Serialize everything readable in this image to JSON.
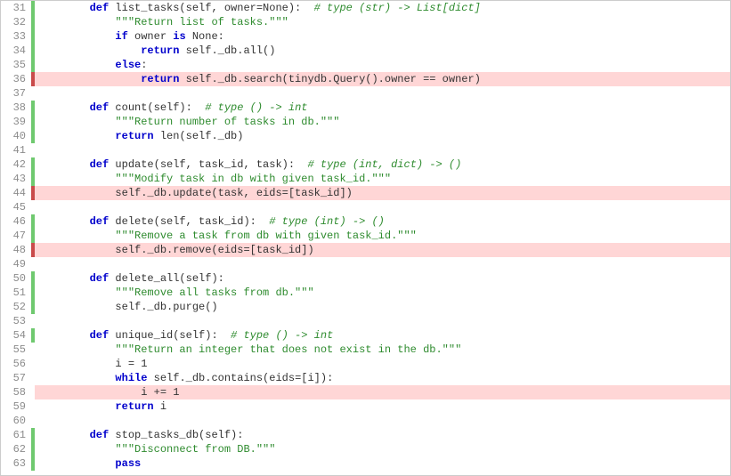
{
  "lines": [
    {
      "n": "31",
      "bar": "green",
      "hl": false,
      "segs": [
        {
          "t": "        "
        },
        {
          "t": "def",
          "c": "kw"
        },
        {
          "t": " list_tasks(self, owner=None):  "
        },
        {
          "t": "# type (str) -> List[dict]",
          "c": "cm"
        }
      ]
    },
    {
      "n": "32",
      "bar": "green",
      "hl": false,
      "segs": [
        {
          "t": "            "
        },
        {
          "t": "\"\"\"Return list of tasks.\"\"\"",
          "c": "st"
        }
      ]
    },
    {
      "n": "33",
      "bar": "green",
      "hl": false,
      "segs": [
        {
          "t": "            "
        },
        {
          "t": "if",
          "c": "kw"
        },
        {
          "t": " owner "
        },
        {
          "t": "is",
          "c": "kw"
        },
        {
          "t": " None:"
        }
      ]
    },
    {
      "n": "34",
      "bar": "green",
      "hl": false,
      "segs": [
        {
          "t": "                "
        },
        {
          "t": "return",
          "c": "kw"
        },
        {
          "t": " self._db.all()"
        }
      ]
    },
    {
      "n": "35",
      "bar": "green",
      "hl": false,
      "segs": [
        {
          "t": "            "
        },
        {
          "t": "else",
          "c": "kw"
        },
        {
          "t": ":"
        }
      ]
    },
    {
      "n": "36",
      "bar": "red",
      "hl": true,
      "segs": [
        {
          "t": "                "
        },
        {
          "t": "return",
          "c": "kw"
        },
        {
          "t": " self._db.search(tinydb.Query().owner == owner)"
        }
      ]
    },
    {
      "n": "37",
      "bar": "",
      "hl": false,
      "segs": [
        {
          "t": ""
        }
      ]
    },
    {
      "n": "38",
      "bar": "green",
      "hl": false,
      "segs": [
        {
          "t": "        "
        },
        {
          "t": "def",
          "c": "kw"
        },
        {
          "t": " count(self):  "
        },
        {
          "t": "# type () -> int",
          "c": "cm"
        }
      ]
    },
    {
      "n": "39",
      "bar": "green",
      "hl": false,
      "segs": [
        {
          "t": "            "
        },
        {
          "t": "\"\"\"Return number of tasks in db.\"\"\"",
          "c": "st"
        }
      ]
    },
    {
      "n": "40",
      "bar": "green",
      "hl": false,
      "segs": [
        {
          "t": "            "
        },
        {
          "t": "return",
          "c": "kw"
        },
        {
          "t": " len(self._db)"
        }
      ]
    },
    {
      "n": "41",
      "bar": "",
      "hl": false,
      "segs": [
        {
          "t": ""
        }
      ]
    },
    {
      "n": "42",
      "bar": "green",
      "hl": false,
      "segs": [
        {
          "t": "        "
        },
        {
          "t": "def",
          "c": "kw"
        },
        {
          "t": " update(self, task_id, task):  "
        },
        {
          "t": "# type (int, dict) -> ()",
          "c": "cm"
        }
      ]
    },
    {
      "n": "43",
      "bar": "green",
      "hl": false,
      "segs": [
        {
          "t": "            "
        },
        {
          "t": "\"\"\"Modify task in db with given task_id.\"\"\"",
          "c": "st"
        }
      ]
    },
    {
      "n": "44",
      "bar": "red",
      "hl": true,
      "segs": [
        {
          "t": "            self._db.update(task, eids=[task_id])"
        }
      ]
    },
    {
      "n": "45",
      "bar": "",
      "hl": false,
      "segs": [
        {
          "t": ""
        }
      ]
    },
    {
      "n": "46",
      "bar": "green",
      "hl": false,
      "segs": [
        {
          "t": "        "
        },
        {
          "t": "def",
          "c": "kw"
        },
        {
          "t": " delete(self, task_id):  "
        },
        {
          "t": "# type (int) -> ()",
          "c": "cm"
        }
      ]
    },
    {
      "n": "47",
      "bar": "green",
      "hl": false,
      "segs": [
        {
          "t": "            "
        },
        {
          "t": "\"\"\"Remove a task from db with given task_id.\"\"\"",
          "c": "st"
        }
      ]
    },
    {
      "n": "48",
      "bar": "red",
      "hl": true,
      "segs": [
        {
          "t": "            self._db.remove(eids=[task_id])"
        }
      ]
    },
    {
      "n": "49",
      "bar": "",
      "hl": false,
      "segs": [
        {
          "t": ""
        }
      ]
    },
    {
      "n": "50",
      "bar": "green",
      "hl": false,
      "segs": [
        {
          "t": "        "
        },
        {
          "t": "def",
          "c": "kw"
        },
        {
          "t": " delete_all(self):"
        }
      ]
    },
    {
      "n": "51",
      "bar": "green",
      "hl": false,
      "segs": [
        {
          "t": "            "
        },
        {
          "t": "\"\"\"Remove all tasks from db.\"\"\"",
          "c": "st"
        }
      ]
    },
    {
      "n": "52",
      "bar": "green",
      "hl": false,
      "segs": [
        {
          "t": "            self._db.purge()"
        }
      ]
    },
    {
      "n": "53",
      "bar": "",
      "hl": false,
      "segs": [
        {
          "t": ""
        }
      ]
    },
    {
      "n": "54",
      "bar": "green",
      "hl": false,
      "segs": [
        {
          "t": "        "
        },
        {
          "t": "def",
          "c": "kw"
        },
        {
          "t": " unique_id(self):  "
        },
        {
          "t": "# type () -> int",
          "c": "cm"
        }
      ]
    },
    {
      "n": "55",
      "bar": "",
      "hl": false,
      "segs": [
        {
          "t": "            "
        },
        {
          "t": "\"\"\"Return an integer that does not exist in the db.\"\"\"",
          "c": "st"
        }
      ]
    },
    {
      "n": "56",
      "bar": "",
      "hl": false,
      "segs": [
        {
          "t": "            i = 1"
        }
      ]
    },
    {
      "n": "57",
      "bar": "",
      "hl": false,
      "segs": [
        {
          "t": "            "
        },
        {
          "t": "while",
          "c": "kw"
        },
        {
          "t": " self._db.contains(eids=[i]):"
        }
      ]
    },
    {
      "n": "58",
      "bar": "",
      "hl": true,
      "segs": [
        {
          "t": "                i += 1"
        }
      ]
    },
    {
      "n": "59",
      "bar": "",
      "hl": false,
      "segs": [
        {
          "t": "            "
        },
        {
          "t": "return",
          "c": "kw"
        },
        {
          "t": " i"
        }
      ]
    },
    {
      "n": "60",
      "bar": "",
      "hl": false,
      "segs": [
        {
          "t": ""
        }
      ]
    },
    {
      "n": "61",
      "bar": "green",
      "hl": false,
      "segs": [
        {
          "t": "        "
        },
        {
          "t": "def",
          "c": "kw"
        },
        {
          "t": " stop_tasks_db(self):"
        }
      ]
    },
    {
      "n": "62",
      "bar": "green",
      "hl": false,
      "segs": [
        {
          "t": "            "
        },
        {
          "t": "\"\"\"Disconnect from DB.\"\"\"",
          "c": "st"
        }
      ]
    },
    {
      "n": "63",
      "bar": "green",
      "hl": false,
      "segs": [
        {
          "t": "            "
        },
        {
          "t": "pass",
          "c": "kw"
        }
      ]
    }
  ]
}
